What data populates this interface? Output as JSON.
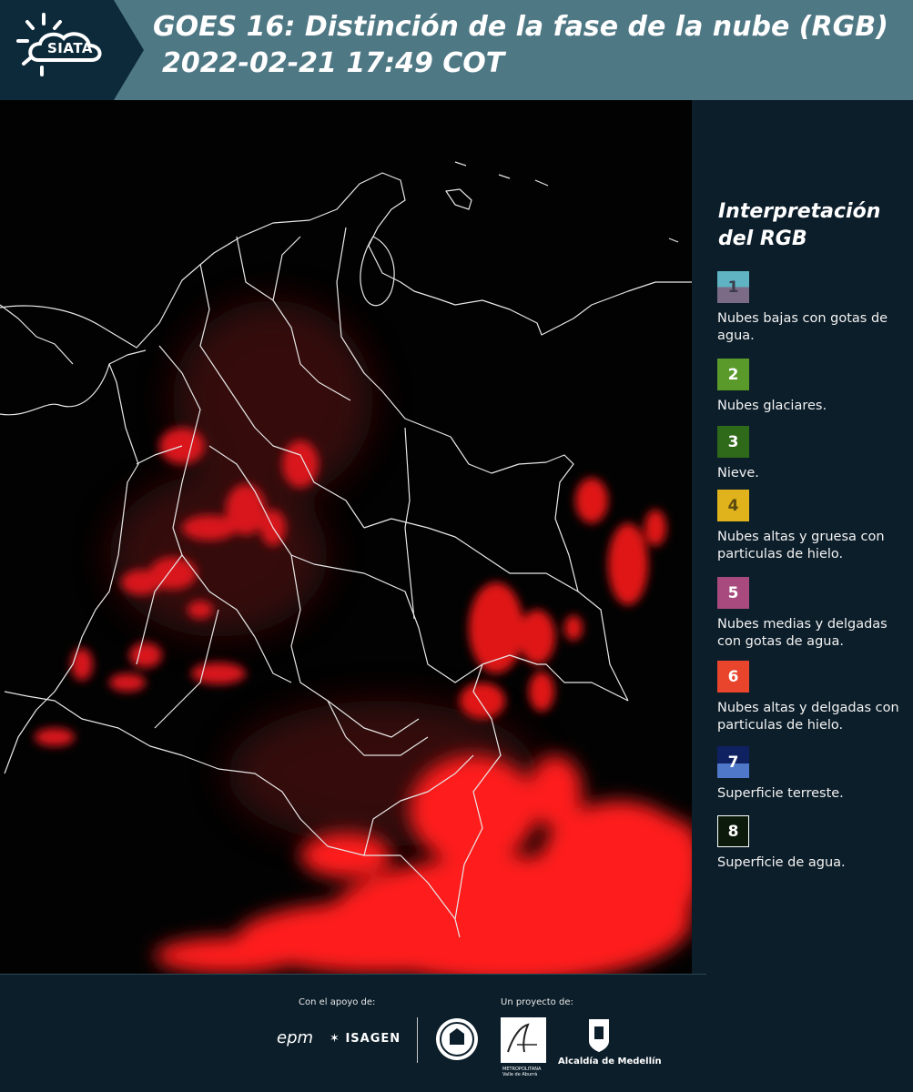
{
  "header": {
    "logo_text": "SIATA",
    "title_line1": "GOES 16: Distinción de la fase de la nube (RGB)",
    "title_line2": "2022-02-21 17:49 COT",
    "bg_color": "#4f7885"
  },
  "map": {
    "background": "#020202",
    "cloud_color": "#ff1a1a",
    "border_color": "#e8e8e8"
  },
  "legend": {
    "title_line1": "Interpretación",
    "title_line2": "del RGB",
    "items": [
      {
        "number": "1",
        "label": "Nubes bajas con gotas de agua.",
        "color_top": "#5fb3c2",
        "color_bottom": "#7c6b86"
      },
      {
        "number": "2",
        "label": "Nubes glaciares.",
        "color_top": "#5a9a2a",
        "color_bottom": "#5a9a2a"
      },
      {
        "number": "3",
        "label": "Nieve.",
        "color_top": "#2f6a1a",
        "color_bottom": "#2f6a1a"
      },
      {
        "number": "4",
        "label": "Nubes altas y gruesa con particulas de hielo.",
        "color_top": "#e0b21c",
        "color_bottom": "#e0b21c"
      },
      {
        "number": "5",
        "label": "Nubes medias y delgadas con gotas de agua.",
        "color_top": "#a84a7e",
        "color_bottom": "#a84a7e"
      },
      {
        "number": "6",
        "label": "Nubes altas y delgadas con particulas de hielo.",
        "color_top": "#e8452c",
        "color_bottom": "#e8452c"
      },
      {
        "number": "7",
        "label": "Superficie terreste.",
        "color_top": "#0f2160",
        "color_bottom": "#4f78c8"
      },
      {
        "number": "8",
        "label": "Superficie de agua.",
        "color_top": "#0b1a0b",
        "color_bottom": "#0b1a0b"
      }
    ]
  },
  "footer": {
    "support_label": "Con el apoyo de:",
    "project_label": "Un proyecto de:",
    "sponsor_1": "epm",
    "sponsor_2": "ISAGEN",
    "area_text": "METROPOLITANA",
    "area_sub": "Valle de Aburrá",
    "alcaldia": "Alcaldía de Medellín"
  }
}
